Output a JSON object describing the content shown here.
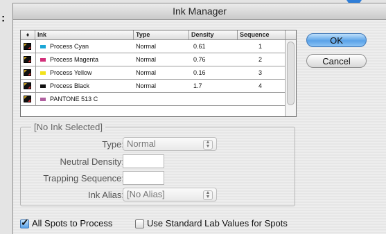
{
  "window": {
    "title": "Ink Manager"
  },
  "ink_table": {
    "columns": [
      "Ink",
      "Type",
      "Density",
      "Sequence"
    ],
    "rows": [
      {
        "ink": "Process Cyan",
        "swatch": "#1aa6d6",
        "type": "Normal",
        "density": "0.61",
        "sequence": "1",
        "icon": "process-ink-icon"
      },
      {
        "ink": "Process Magenta",
        "swatch": "#d2307a",
        "type": "Normal",
        "density": "0.76",
        "sequence": "2",
        "icon": "process-ink-icon"
      },
      {
        "ink": "Process Yellow",
        "swatch": "#f2e21a",
        "type": "Normal",
        "density": "0.16",
        "sequence": "3",
        "icon": "process-ink-icon"
      },
      {
        "ink": "Process Black",
        "swatch": "#111111",
        "type": "Normal",
        "density": "1.7",
        "sequence": "4",
        "icon": "process-ink-icon"
      },
      {
        "ink": "PANTONE 513 C",
        "swatch": "#b060a0",
        "type": "",
        "density": "",
        "sequence": "",
        "icon": "process-ink-icon"
      }
    ]
  },
  "buttons": {
    "ok": "OK",
    "cancel": "Cancel"
  },
  "ink_details": {
    "group_title": "[No Ink Selected]",
    "type_label": "Type:",
    "type_value": "Normal",
    "neutral_density_label": "Neutral Density:",
    "neutral_density_value": "",
    "trapping_sequence_label": "Trapping Sequence:",
    "trapping_sequence_value": "",
    "ink_alias_label": "Ink Alias:",
    "ink_alias_value": "[No Alias]"
  },
  "options": {
    "all_spots_to_process": {
      "label": "All Spots to Process",
      "checked": true
    },
    "use_standard_lab": {
      "label": "Use Standard Lab Values for Spots",
      "checked": false
    }
  }
}
